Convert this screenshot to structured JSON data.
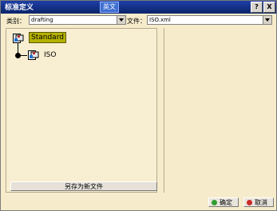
{
  "window": {
    "title": "标准定义",
    "ime_badge": "英文",
    "help_label": "?",
    "close_label": "X"
  },
  "filters": {
    "category_label": "类别：",
    "category_value": "drafting",
    "file_label": "文件：",
    "file_value": "ISO.xml"
  },
  "tree": {
    "root_label": "Standard",
    "child_label": "ISO"
  },
  "buttons": {
    "save_as": "另存为新文件",
    "ok": "确定",
    "cancel": "取消"
  },
  "colors": {
    "ok_icon": "#2f9e2f",
    "cancel_icon": "#cc2a2a",
    "selection": "#b5b100"
  },
  "icons": {
    "root": "document-tree-icon",
    "child": "document-tree-icon"
  }
}
